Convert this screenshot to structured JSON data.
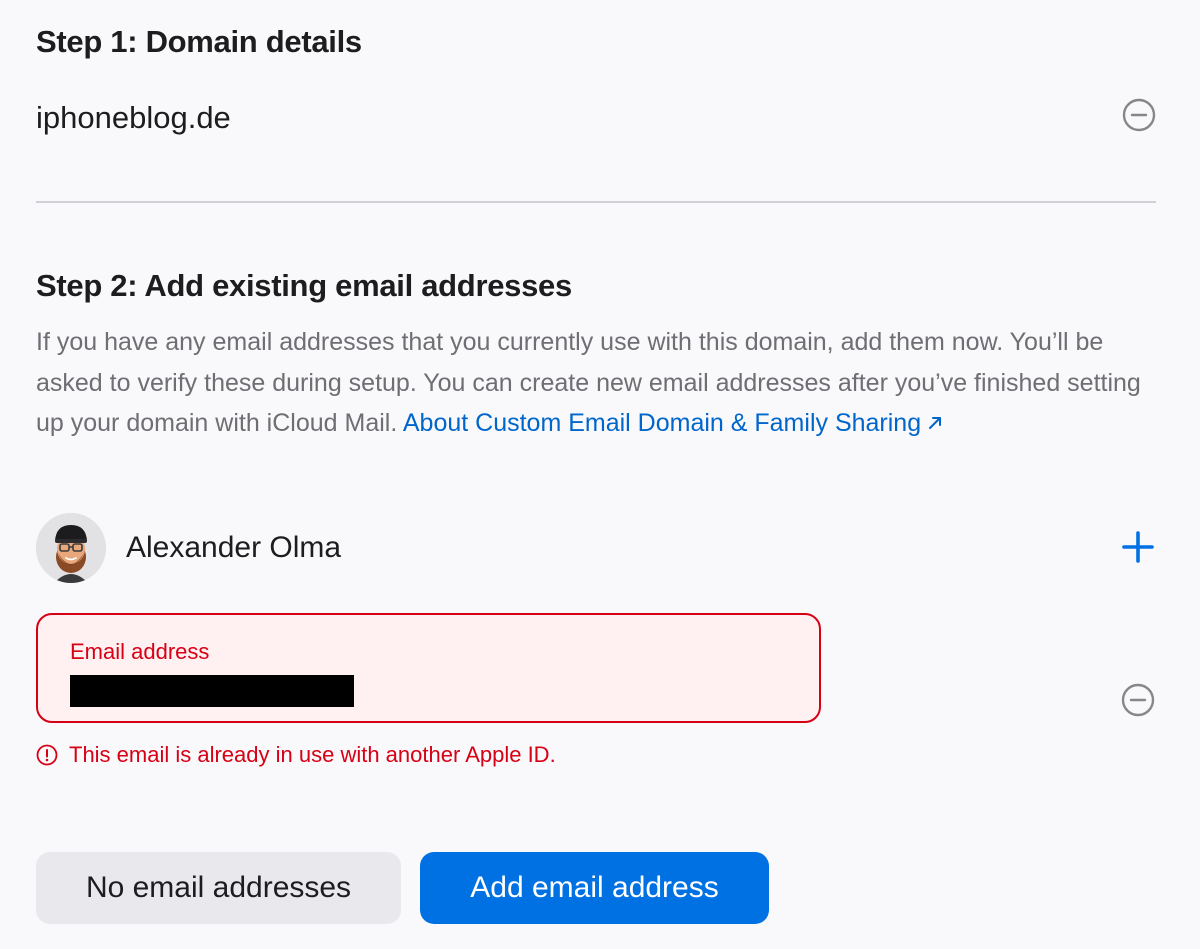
{
  "step1": {
    "title": "Step 1: Domain details",
    "domain": "iphoneblog.de",
    "remove_icon": "minus-circle-icon"
  },
  "step2": {
    "title": "Step 2: Add existing email addresses",
    "description": "If you have any email addresses that you currently use with this domain, add them now. You’ll be asked to verify these during setup. You can create new email addresses after you’ve finished setting up your domain with iCloud Mail. ",
    "link_text": "About Custom Email Domain & Family Sharing",
    "link_icon": "external-arrow-icon"
  },
  "member": {
    "name": "Alexander Olma",
    "avatar": "memoji-avatar",
    "add_icon": "plus-icon"
  },
  "email_field": {
    "label": "Email address",
    "value": "",
    "remove_icon": "minus-circle-icon"
  },
  "error": {
    "icon": "exclamation-circle-icon",
    "message": "This email is already in use with another Apple ID."
  },
  "buttons": {
    "no_emails": "No email addresses",
    "add_email": "Add email address"
  },
  "colors": {
    "accent": "#0071e3",
    "link": "#0066cc",
    "error": "#d70015",
    "error_bg": "#fff0f1",
    "secondary_button": "#e8e8ed"
  }
}
